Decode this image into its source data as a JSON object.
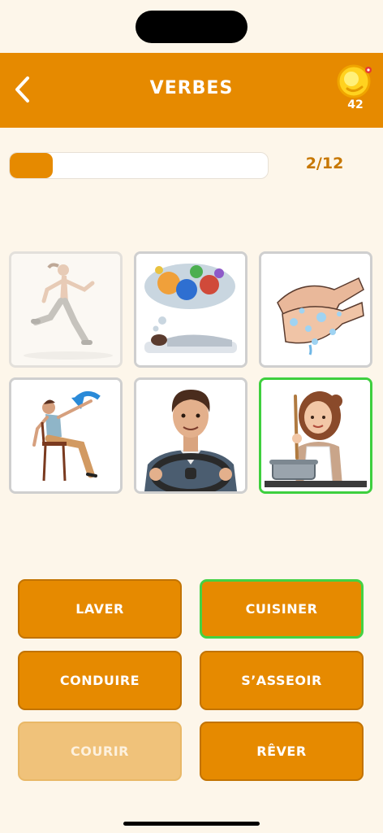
{
  "header": {
    "title": "VERBES",
    "coins": "42",
    "accent": "#E68A00"
  },
  "progress": {
    "label": "2/12",
    "fraction": 0.167
  },
  "images": [
    {
      "name": "running-woman",
      "state": "faded"
    },
    {
      "name": "dreaming-sleeper",
      "state": "normal"
    },
    {
      "name": "washing-hands",
      "state": "normal"
    },
    {
      "name": "sitting-woman",
      "state": "normal"
    },
    {
      "name": "driving-man",
      "state": "normal"
    },
    {
      "name": "cooking-woman",
      "state": "selected"
    }
  ],
  "choices": [
    {
      "label": "LAVER",
      "state": "normal"
    },
    {
      "label": "CUISINER",
      "state": "selected"
    },
    {
      "label": "CONDUIRE",
      "state": "normal"
    },
    {
      "label": "S’ASSEOIR",
      "state": "normal"
    },
    {
      "label": "COURIR",
      "state": "disabled"
    },
    {
      "label": "RÊVER",
      "state": "normal"
    }
  ]
}
